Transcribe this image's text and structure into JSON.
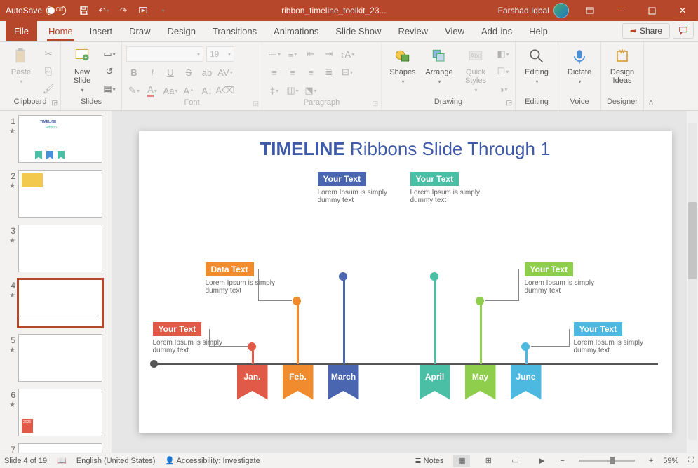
{
  "titlebar": {
    "autosave_label": "AutoSave",
    "autosave_state": "Off",
    "filename": "ribbon_timeline_toolkit_23...",
    "user": "Farshad Iqbal"
  },
  "tabs": {
    "file": "File",
    "items": [
      "Home",
      "Insert",
      "Draw",
      "Design",
      "Transitions",
      "Animations",
      "Slide Show",
      "Review",
      "View",
      "Add-ins",
      "Help"
    ],
    "active": "Home",
    "share": "Share"
  },
  "ribbon": {
    "clipboard": {
      "paste": "Paste",
      "label": "Clipboard"
    },
    "slides": {
      "new": "New\nSlide",
      "label": "Slides"
    },
    "font": {
      "label": "Font",
      "size": "19"
    },
    "paragraph": {
      "label": "Paragraph"
    },
    "drawing": {
      "shapes": "Shapes",
      "arrange": "Arrange",
      "quick": "Quick\nStyles",
      "label": "Drawing"
    },
    "editing": {
      "label": "Editing",
      "btn": "Editing"
    },
    "voice": {
      "dictate": "Dictate",
      "label": "Voice"
    },
    "designer": {
      "ideas": "Design\nIdeas",
      "label": "Designer"
    }
  },
  "slide": {
    "title_bold": "TIMELINE",
    "title_rest": " Ribbons Slide Through 1",
    "months": [
      "Jan.",
      "Feb.",
      "March",
      "April",
      "May",
      "June"
    ],
    "colors": [
      "#e05a47",
      "#f08c2e",
      "#4a66b0",
      "#4bbfa6",
      "#8fce4d",
      "#4db8e0"
    ],
    "callouts": [
      {
        "tag": "Your Text",
        "body": "Lorem Ipsum is simply dummy text"
      },
      {
        "tag": "Data Text",
        "body": "Lorem Ipsum is simply dummy text"
      },
      {
        "tag": "Your Text",
        "body": "Lorem Ipsum is simply dummy text"
      },
      {
        "tag": "Your Text",
        "body": "Lorem Ipsum is simply dummy text"
      },
      {
        "tag": "Your Text",
        "body": "Lorem Ipsum is simply dummy text"
      },
      {
        "tag": "Your Text",
        "body": "Lorem Ipsum is simply dummy text"
      }
    ]
  },
  "status": {
    "slide": "Slide 4 of 19",
    "lang": "English (United States)",
    "access": "Accessibility: Investigate",
    "notes": "Notes",
    "zoom": "59%"
  },
  "thumb_count": 7
}
